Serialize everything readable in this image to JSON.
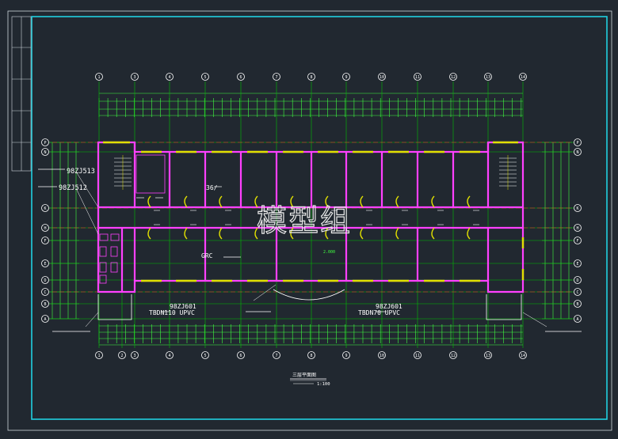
{
  "grid_top": [
    "1",
    "3",
    "4",
    "5",
    "6",
    "7",
    "8",
    "9",
    "10",
    "11",
    "12",
    "13",
    "14"
  ],
  "grid_bottom": [
    "1",
    "2",
    "3",
    "4",
    "5",
    "6",
    "7",
    "8",
    "9",
    "10",
    "11",
    "12",
    "13",
    "14"
  ],
  "grid_side": [
    "P",
    "N",
    "K",
    "H",
    "F",
    "E",
    "D",
    "C",
    "B",
    "A"
  ],
  "annotations": {
    "ref_top_1": "98ZJ513",
    "ref_top_2": "98ZJ512",
    "room_tag": "36/",
    "grc_label": "GRC",
    "level": "2.000",
    "door_left_ref": "98ZJ601",
    "door_left_spec": "TBDN110 UPVC",
    "door_right_ref": "98ZJ601",
    "door_right_spec": "TBDN70 UPVC"
  },
  "watermark": "模型组",
  "footer": {
    "title": "三层平面图",
    "scale": "1:100"
  },
  "colors": {
    "background": "#212830",
    "frame": "#20d0e0",
    "grid": "#00c000",
    "walls": "#ff40ff",
    "windows": "#e0e000",
    "dims": "#40ff40",
    "text": "#ffffff"
  }
}
